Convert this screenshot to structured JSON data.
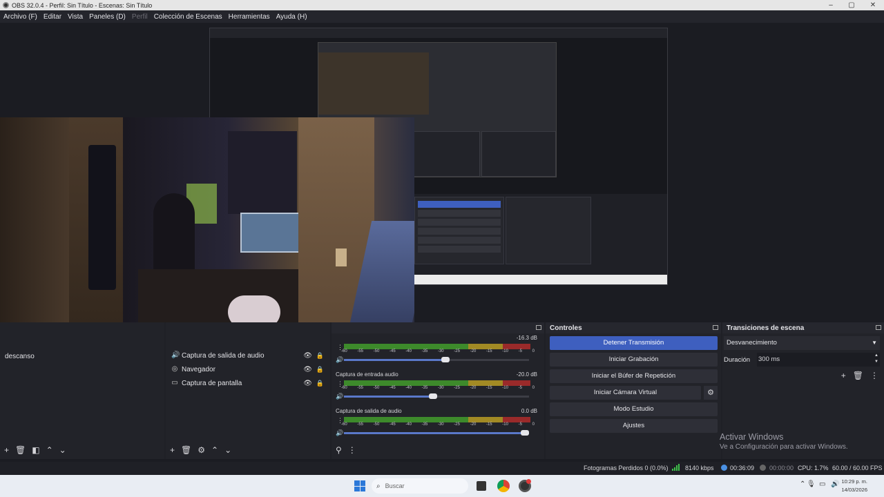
{
  "window": {
    "title": "OBS 32.0.4 - Perfil: Sin Título - Escenas: Sin Título"
  },
  "menu": {
    "file": "Archivo (F)",
    "edit": "Editar",
    "view": "Vista",
    "docks": "Paneles (D)",
    "profile": "Perfil",
    "scene_collection": "Colección de Escenas",
    "tools": "Herramientas",
    "help": "Ayuda (H)"
  },
  "scenes": {
    "items": [
      "descanso"
    ]
  },
  "sources": {
    "items": [
      {
        "label": "Captura de salida de audio",
        "icon": "speaker-icon"
      },
      {
        "label": "Navegador",
        "icon": "globe-icon"
      },
      {
        "label": "Captura de pantalla",
        "icon": "monitor-icon"
      }
    ]
  },
  "mixer": {
    "tracks": [
      {
        "name": "",
        "db": "-16.3 dB",
        "fader_level": 0.55
      },
      {
        "name": "Captura de entrada audio",
        "db": "-20.0 dB",
        "fader_level": 0.48
      },
      {
        "name": "Captura de salida de audio",
        "db": "0.0 dB",
        "fader_level": 1.0
      }
    ],
    "scale": [
      "-60",
      "-55",
      "-50",
      "-45",
      "-40",
      "-35",
      "-30",
      "-25",
      "-20",
      "-15",
      "-10",
      "-5",
      "0"
    ]
  },
  "controls": {
    "title": "Controles",
    "stop_stream": "Detener Transmisión",
    "start_recording": "Iniciar Grabación",
    "start_replay_buffer": "Iniciar el Búfer de Repetición",
    "start_virtual_cam": "Iniciar Cámara Virtual",
    "studio_mode": "Modo Estudio",
    "settings": "Ajustes"
  },
  "transitions": {
    "title": "Transiciones de escena",
    "selected": "Desvanecimiento",
    "duration_label": "Duración",
    "duration_value": "300 ms"
  },
  "watermark": {
    "line1": "Activar Windows",
    "line2": "Ve a Configuración para activar Windows."
  },
  "status": {
    "dropped_frames": "Fotogramas Perdidos 0 (0.0%)",
    "bitrate": "8140 kbps",
    "stream_time": "00:36:09",
    "rec_time": "00:00:00",
    "cpu": "CPU: 1.7%",
    "fps": "60.00 / 60.00 FPS"
  },
  "taskbar": {
    "search_placeholder": "Buscar",
    "time": "10:29 p. m.",
    "date": "14/03/2026"
  },
  "colors": {
    "accent": "#3e5fbf",
    "stream_green": "#3ec24a",
    "dock_bg": "#222329"
  }
}
